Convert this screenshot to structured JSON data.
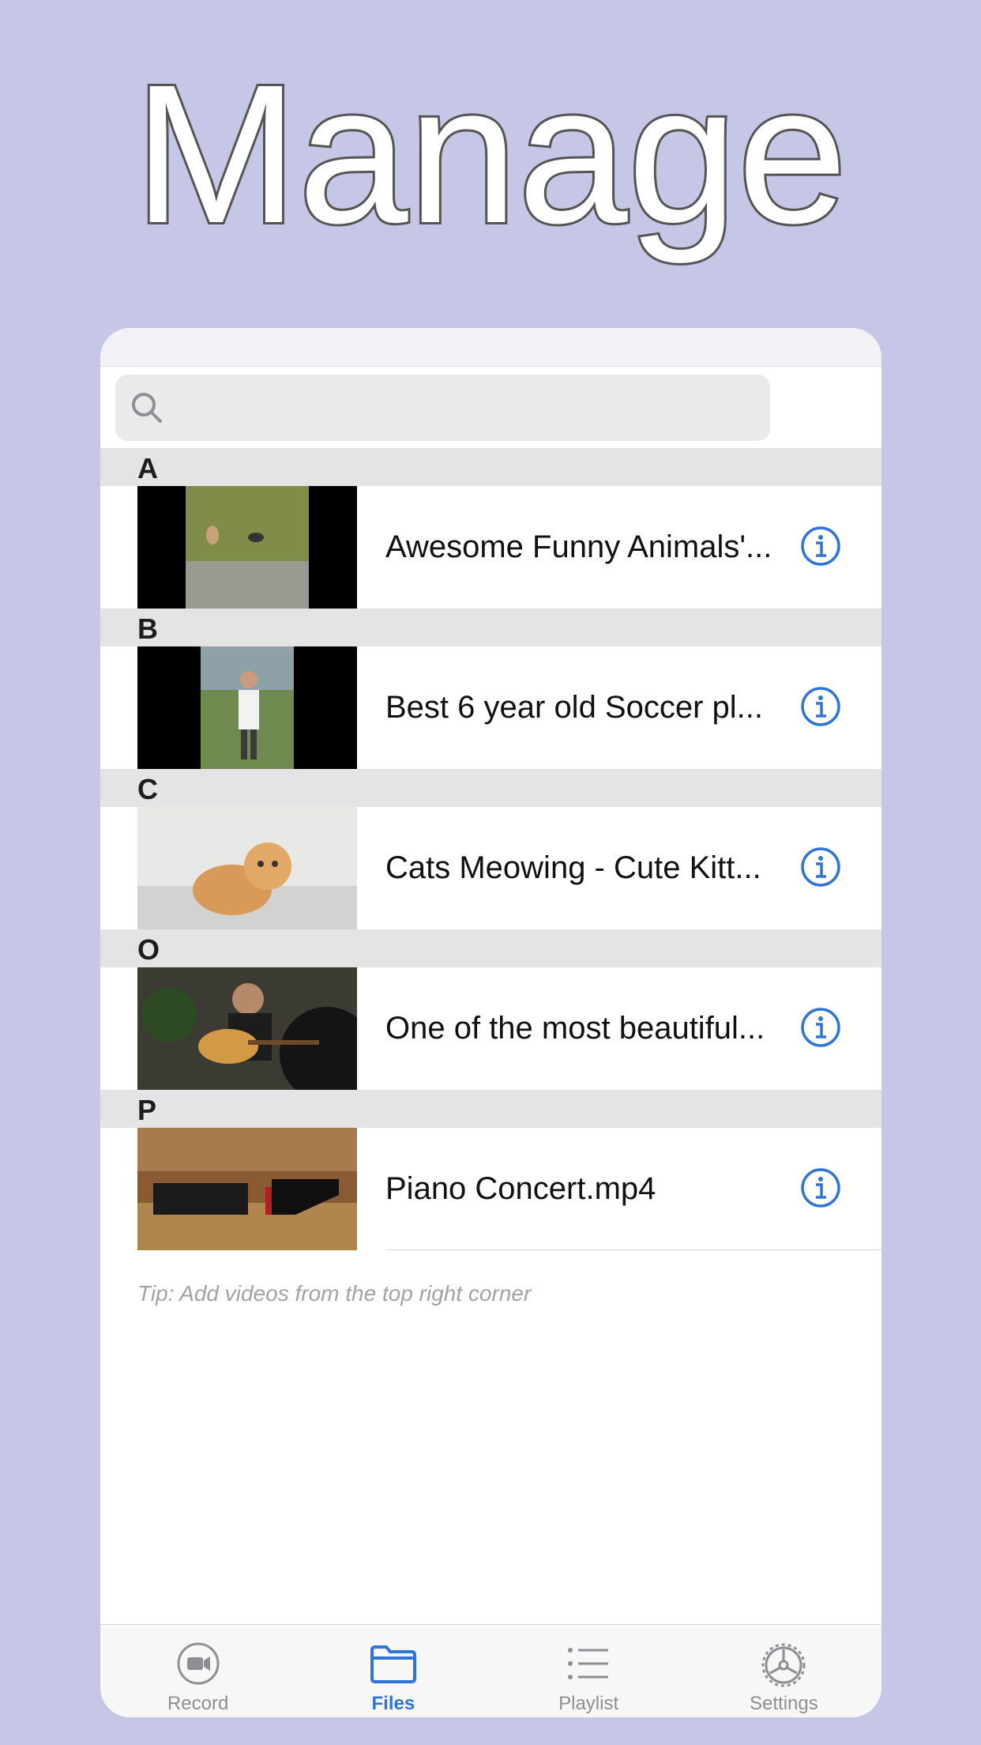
{
  "hero_title": "Manage",
  "search": {
    "placeholder": ""
  },
  "sections": [
    {
      "letter": "A",
      "title": "Awesome Funny Animals'..."
    },
    {
      "letter": "B",
      "title": "Best 6 year old Soccer pl..."
    },
    {
      "letter": "C",
      "title": "Cats Meowing - Cute Kitt..."
    },
    {
      "letter": "O",
      "title": "One of the most beautiful..."
    },
    {
      "letter": "P",
      "title": "Piano Concert.mp4"
    }
  ],
  "tip": "Tip: Add videos from the top right corner",
  "tabs": [
    {
      "label": "Record",
      "icon": "video-camera-icon",
      "active": false
    },
    {
      "label": "Files",
      "icon": "folder-icon",
      "active": true
    },
    {
      "label": "Playlist",
      "icon": "list-icon",
      "active": false
    },
    {
      "label": "Settings",
      "icon": "gear-icon",
      "active": false
    }
  ],
  "colors": {
    "background": "#c6c6e7",
    "accent": "#2f74d8",
    "inactive": "#8e8e93"
  }
}
